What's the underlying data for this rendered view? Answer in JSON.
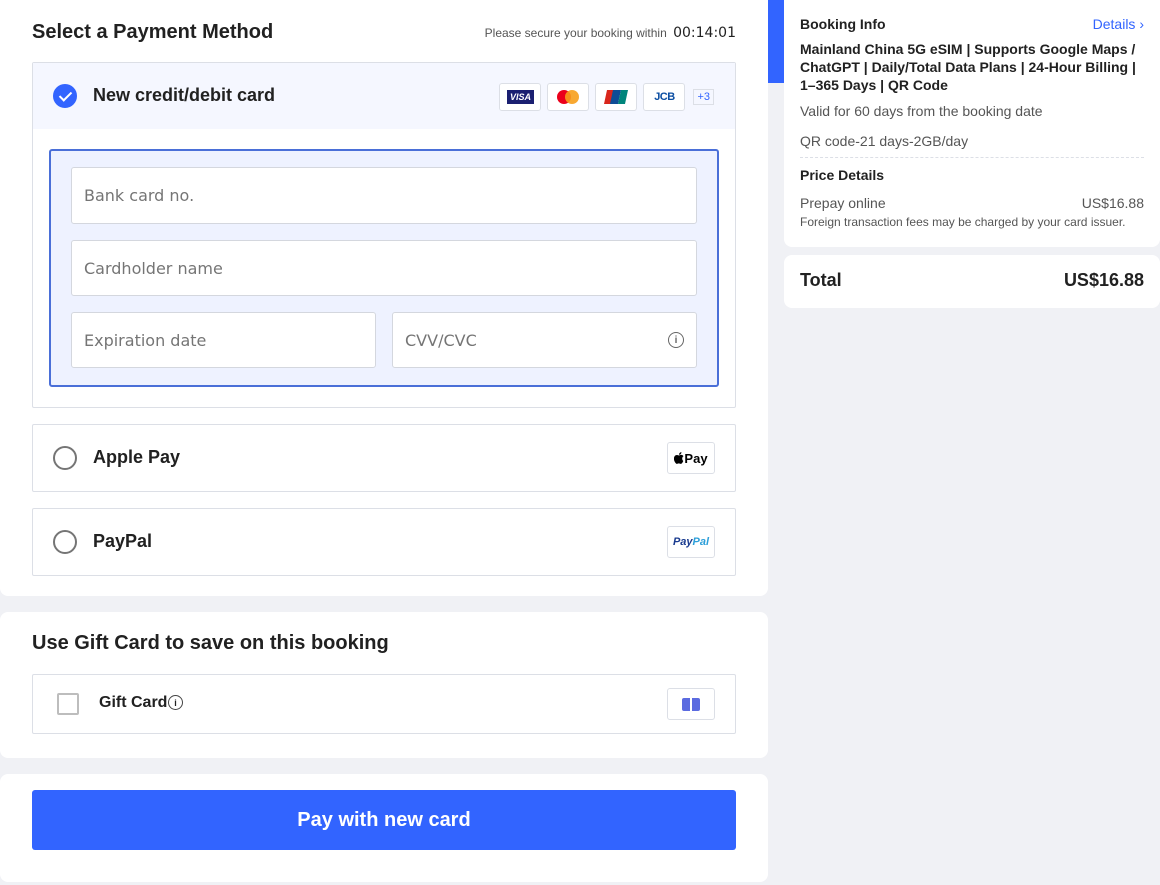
{
  "payment": {
    "title": "Select a Payment Method",
    "timer_text": "Please secure your booking within",
    "timer_value": "00:14:01",
    "card": {
      "label": "New credit/debit card",
      "logos": [
        "visa-logo",
        "mastercard-logo",
        "unionpay-logo",
        "jcb-logo"
      ],
      "visa_text": "VISA",
      "jcb_text": "JCB",
      "more": "+3",
      "card_no_placeholder": "Bank card no.",
      "holder_placeholder": "Cardholder name",
      "expiry_placeholder": "Expiration date",
      "cvv_placeholder": "CVV/CVC"
    },
    "apple_pay": {
      "label": "Apple Pay",
      "logo_text": "Pay"
    },
    "paypal": {
      "label": "PayPal",
      "logo_text_a": "Pay",
      "logo_text_b": "Pal"
    }
  },
  "gift": {
    "title": "Use Gift Card to save on this booking",
    "label": "Gift Card"
  },
  "pay_button": "Pay with new card",
  "booking": {
    "title": "Booking Info",
    "details_link": "Details",
    "product": "Mainland China 5G eSIM | Supports Google Maps / ChatGPT | Daily/Total Data Plans | 24-Hour Billing | 1–365 Days | QR Code",
    "validity": "Valid for 60 days from the booking date",
    "package": "QR code-21 days-2GB/day",
    "price_title": "Price Details",
    "prepay_label": "Prepay online",
    "prepay_value": "US$16.88",
    "fee_note": "Foreign transaction fees may be charged by your card issuer.",
    "total_label": "Total",
    "total_value": "US$16.88"
  },
  "colors": {
    "accent": "#3264ff",
    "background": "#f0f1f5"
  }
}
